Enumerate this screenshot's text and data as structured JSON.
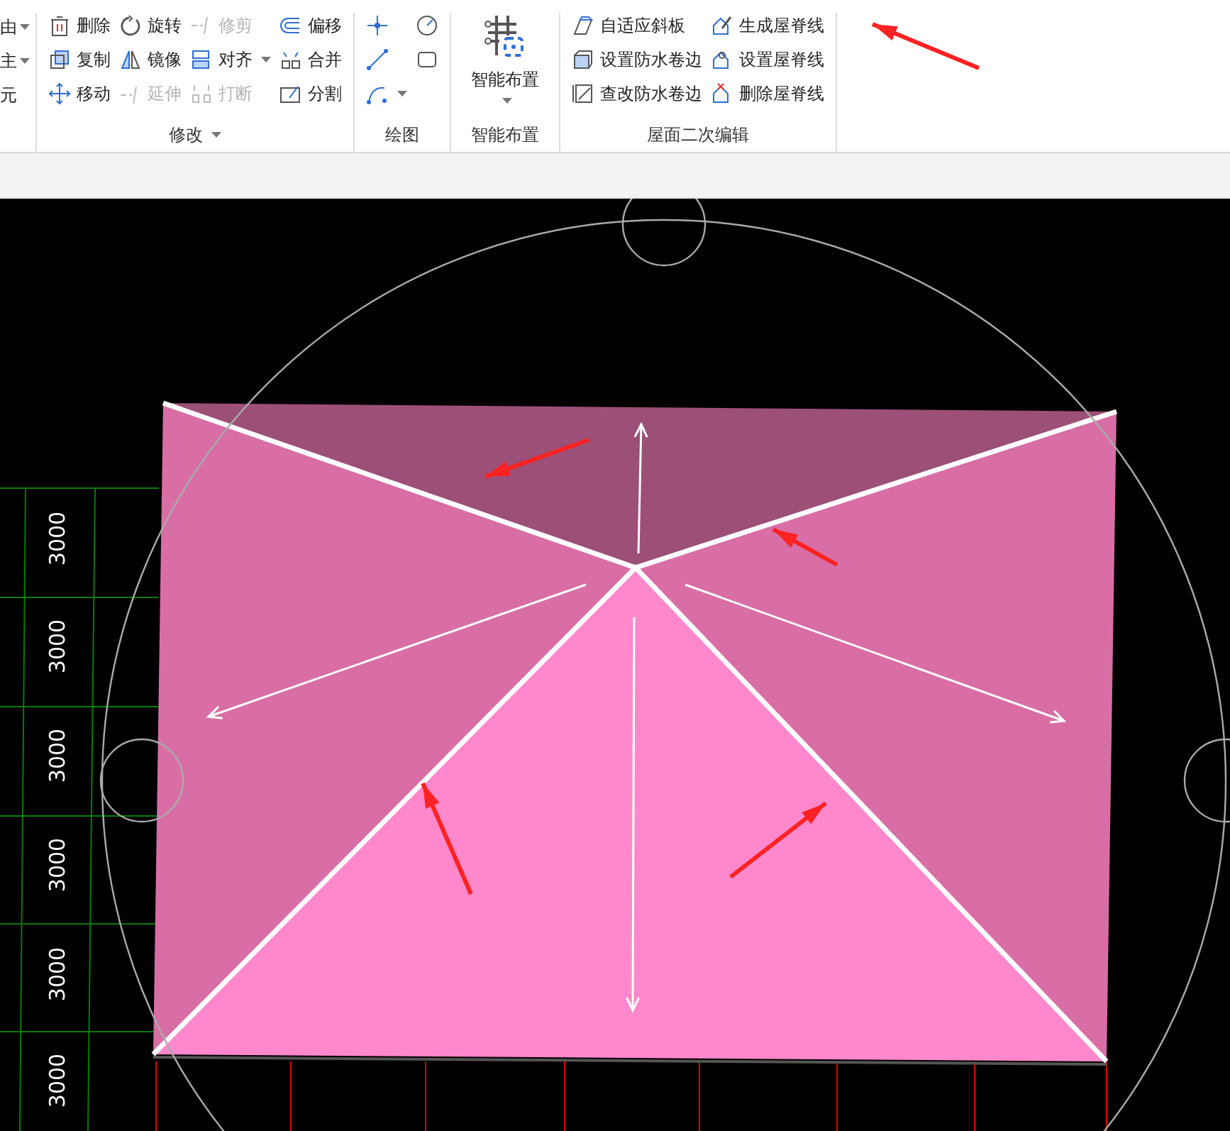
{
  "ribbon": {
    "cut_column": [
      {
        "label": "由",
        "dropdown": true
      },
      {
        "label": "主",
        "dropdown": true
      },
      {
        "label": "元"
      }
    ],
    "groups": [
      {
        "label": "修改",
        "menu": true,
        "columns": [
          [
            {
              "label": "删除",
              "disabled": false
            },
            {
              "label": "复制",
              "disabled": false
            },
            {
              "label": "移动",
              "disabled": false
            }
          ],
          [
            {
              "label": "旋转",
              "disabled": false
            },
            {
              "label": "镜像",
              "disabled": false
            },
            {
              "label": "延伸",
              "disabled": true
            }
          ],
          [
            {
              "label": "修剪",
              "disabled": true
            },
            {
              "label": "对齐",
              "disabled": false,
              "dropdown": true
            },
            {
              "label": "打断",
              "disabled": true
            }
          ],
          [
            {
              "label": "偏移",
              "disabled": false
            },
            {
              "label": "合并",
              "disabled": false
            },
            {
              "label": "分割",
              "disabled": false
            }
          ]
        ]
      },
      {
        "label": "绘图",
        "columns": [
          [
            {
              "kind": "icon"
            },
            {
              "kind": "icon"
            },
            {
              "kind": "icon",
              "dropdown": true
            }
          ],
          [
            {
              "kind": "icon"
            },
            {
              "kind": "icon"
            }
          ]
        ]
      },
      {
        "label": "智能布置",
        "large": {
          "label": "智能布置",
          "dropdown": true
        }
      },
      {
        "label": "屋面二次编辑",
        "columns": [
          [
            {
              "label": "自适应斜板",
              "disabled": false
            },
            {
              "label": "设置防水卷边",
              "disabled": false
            },
            {
              "label": "查改防水卷边",
              "disabled": false
            }
          ],
          [
            {
              "label": "生成屋脊线",
              "disabled": false
            },
            {
              "label": "设置屋脊线",
              "disabled": false
            },
            {
              "label": "删除屋脊线",
              "disabled": false
            }
          ]
        ]
      }
    ]
  },
  "canvas": {
    "axis_dimensions": [
      "3000",
      "3000",
      "3000",
      "3000",
      "3000",
      "3000"
    ]
  }
}
